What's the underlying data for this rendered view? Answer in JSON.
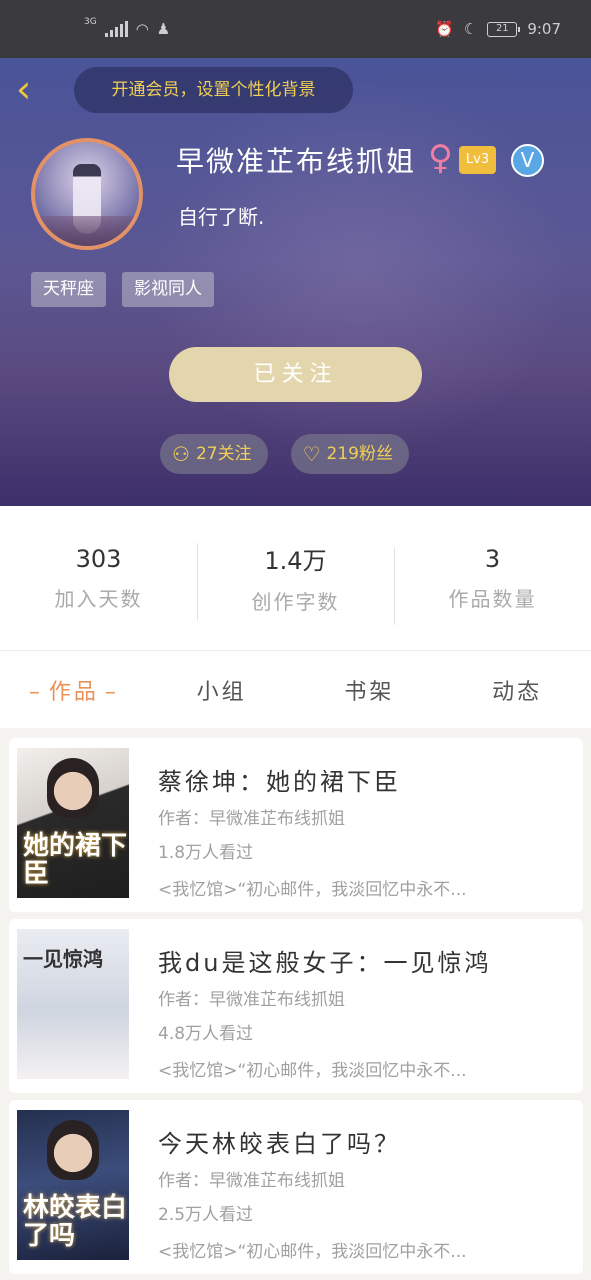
{
  "status_bar": {
    "network": "3G",
    "battery": "21",
    "time": "9:07"
  },
  "header": {
    "back_icon": "chevron-left-icon",
    "vip_prompt": "开通会员，设置个性化背景",
    "nickname": "早微准芷布线抓姐",
    "gender_symbol": "♀",
    "level": "Lv3",
    "verified_symbol": "V",
    "bio": "自行了断.",
    "tags": [
      "天秤座",
      "影视同人"
    ],
    "follow_button": "已关注",
    "following_count": "27关注",
    "fans_count": "219粉丝",
    "accent_color": "#f1cf55"
  },
  "stats": [
    {
      "value": "303",
      "label": "加入天数"
    },
    {
      "value": "1.4万",
      "label": "创作字数"
    },
    {
      "value": "3",
      "label": "作品数量"
    }
  ],
  "tabs": [
    {
      "label": "作品",
      "active": true
    },
    {
      "label": "小组",
      "active": false
    },
    {
      "label": "书架",
      "active": false
    },
    {
      "label": "动态",
      "active": false
    }
  ],
  "books": [
    {
      "title": "蔡徐坤：她的裙下臣",
      "author": "作者：早微准芷布线抓姐",
      "views": "1.8万人看过",
      "desc": "<我忆馆>“初心邮件，我淡回忆中永不...",
      "cover_text": "她的裙下臣"
    },
    {
      "title": "我du是这般女子：一见惊鸿",
      "author": "作者：早微准芷布线抓姐",
      "views": "4.8万人看过",
      "desc": "<我忆馆>“初心邮件，我淡回忆中永不...",
      "cover_text": "一见惊鸿"
    },
    {
      "title": "今天林皎表白了吗？",
      "author": "作者：早微准芷布线抓姐",
      "views": "2.5万人看过",
      "desc": "<我忆馆>“初心邮件，我淡回忆中永不...",
      "cover_text": "林皎表白了吗"
    }
  ]
}
